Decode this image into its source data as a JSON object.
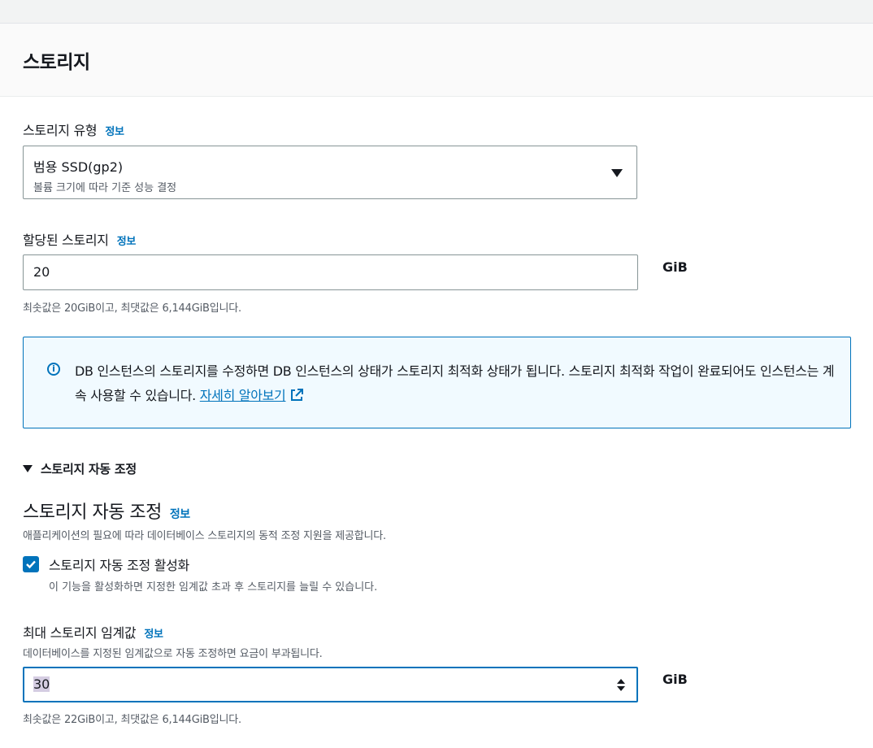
{
  "section": {
    "title": "스토리지"
  },
  "info_label": "정보",
  "storage_type": {
    "label": "스토리지 유형",
    "selected": "범용 SSD(gp2)",
    "description": "볼륨 크기에 따라 기준 성능 결정"
  },
  "allocated_storage": {
    "label": "할당된 스토리지",
    "value": "20",
    "unit": "GiB",
    "hint": "최솟값은 20GiB이고, 최댓값은 6,144GiB입니다."
  },
  "alert": {
    "text": "DB 인스턴스의 스토리지를 수정하면 DB 인스턴스의 상태가 스토리지 최적화 상태가 됩니다. 스토리지 최적화 작업이 완료되어도 인스턴스는 계속 사용할 수 있습니다.",
    "link": "자세히 알아보기"
  },
  "autoscaling": {
    "expander_label": "스토리지 자동 조정",
    "heading": "스토리지 자동 조정",
    "description": "애플리케이션의 필요에 따라 데이터베이스 스토리지의 동적 조정 지원을 제공합니다.",
    "checkbox_label": "스토리지 자동 조정 활성화",
    "checkbox_checked": true,
    "checkbox_description": "이 기능을 활성화하면 지정한 임계값 초과 후 스토리지를 늘릴 수 있습니다."
  },
  "max_threshold": {
    "label": "최대 스토리지 임계값",
    "description": "데이터베이스를 지정된 임계값으로 자동 조정하면 요금이 부과됩니다.",
    "value": "30",
    "unit": "GiB",
    "hint": "최솟값은 22GiB이고, 최댓값은 6,144GiB입니다."
  },
  "colors": {
    "accent": "#0073bb",
    "alert_bg": "#f1faff",
    "selection": "#d5cde2"
  }
}
